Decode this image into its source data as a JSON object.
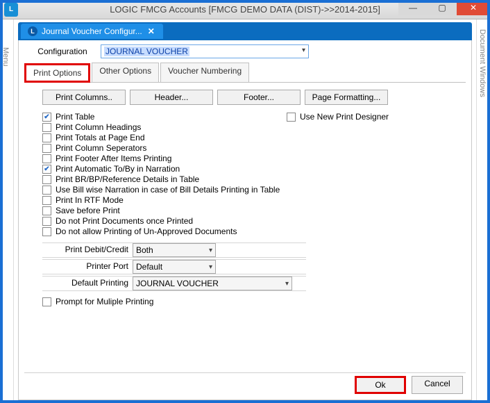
{
  "window": {
    "title": "LOGIC FMCG Accounts  [FMCG DEMO DATA (DIST)->>2014-2015]",
    "min": "—",
    "max": "▢",
    "close": "✕"
  },
  "side_tabs": {
    "left": "Menu",
    "right": "Document Windows"
  },
  "inner_tab": {
    "title": "Journal Voucher Configur...",
    "close": "✕"
  },
  "config": {
    "label": "Configuration",
    "value": "JOURNAL VOUCHER"
  },
  "tabs": {
    "print_options": "Print Options",
    "other_options": "Other Options",
    "voucher_numbering": "Voucher Numbering"
  },
  "buttons": {
    "print_columns": "Print Columns..",
    "header": "Header...",
    "footer": "Footer...",
    "page_formatting": "Page Formatting..."
  },
  "checks": {
    "print_table": "Print Table",
    "use_new_designer": "Use New Print Designer",
    "print_col_headings": "Print Column Headings",
    "print_totals": "Print Totals at Page End",
    "print_col_sep": "Print Column Seperators",
    "print_footer_after": "Print Footer After Items Printing",
    "print_auto_toby": "Print Automatic To/By in Narration",
    "print_br_bp": "Print BR/BP/Reference Details in Table",
    "use_billwise": "Use Bill wise Narration in case of Bill Details Printing in Table",
    "print_rtf": "Print In RTF Mode",
    "save_before": "Save before Print",
    "do_not_print_once": "Do not Print Documents once Printed",
    "do_not_allow_unapproved": "Do not allow Printing of Un-Approved Documents",
    "prompt_multiple": "Prompt for Muliple Printing"
  },
  "form": {
    "print_dc_label": "Print Debit/Credit",
    "print_dc_value": "Both",
    "printer_port_label": "Printer Port",
    "printer_port_value": "Default",
    "default_printing_label": "Default Printing",
    "default_printing_value": "JOURNAL VOUCHER"
  },
  "bottom_buttons": {
    "ok": "Ok",
    "cancel": "Cancel"
  }
}
